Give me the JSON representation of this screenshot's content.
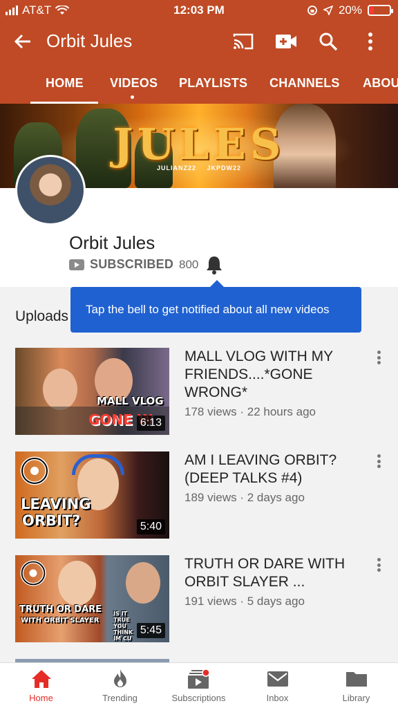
{
  "status_bar": {
    "carrier": "AT&T",
    "time": "12:03 PM",
    "battery_percent": "20%",
    "battery_level": 0.2,
    "battery_color": "#ff3b30"
  },
  "app_bar": {
    "title": "Orbit Jules",
    "background_color": "#bf4a25",
    "icons": [
      "back-arrow-icon",
      "cast-icon",
      "upload-video-icon",
      "search-icon",
      "more-vert-icon"
    ]
  },
  "tabs": [
    {
      "label": "HOME",
      "active": true
    },
    {
      "label": "VIDEOS",
      "active": false,
      "new_dot": true
    },
    {
      "label": "PLAYLISTS",
      "active": false
    },
    {
      "label": "CHANNELS",
      "active": false
    },
    {
      "label": "ABOU",
      "active": false
    }
  ],
  "banner": {
    "brand_text": "JULES",
    "handles": [
      "JULIANZ22",
      "JKPDW22"
    ]
  },
  "channel": {
    "name": "Orbit Jules",
    "subscribed_label": "SUBSCRIBED",
    "subscriber_count": "800"
  },
  "tooltip": {
    "text": "Tap the bell to get notified about all new videos",
    "color": "#1f61d1"
  },
  "uploads_label": "Uploads",
  "videos": [
    {
      "title": "MALL VLOG WITH MY FRIENDS....*GONE WRONG*",
      "views": "178 views",
      "age": "22 hours ago",
      "duration": "6:13",
      "thumb_caption_1": "MALL VLOG",
      "thumb_caption_2": "GONE W"
    },
    {
      "title": "AM I LEAVING ORBIT? (DEEP TALKS #4)",
      "views": "189 views",
      "age": "2 days ago",
      "duration": "5:40",
      "thumb_caption_1": "LEAVING",
      "thumb_caption_2": "ORBIT?"
    },
    {
      "title": "TRUTH OR DARE WITH ORBIT SLAYER ...",
      "views": "191 views",
      "age": "5 days ago",
      "duration": "5:45",
      "thumb_caption_1": "TRUTH OR DARE",
      "thumb_caption_2": "WITH ORBIT SLAYER",
      "thumb_caption_3": "IS IT TRUE YOU THINK IM CU"
    }
  ],
  "meta_separator": "·",
  "bottom_nav": [
    {
      "label": "Home",
      "icon": "home-icon",
      "active": true
    },
    {
      "label": "Trending",
      "icon": "trending-flame-icon",
      "active": false
    },
    {
      "label": "Subscriptions",
      "icon": "subscriptions-icon",
      "active": false,
      "badge": true
    },
    {
      "label": "Inbox",
      "icon": "inbox-mail-icon",
      "active": false
    },
    {
      "label": "Library",
      "icon": "library-folder-icon",
      "active": false
    }
  ],
  "colors": {
    "accent": "#bf4a25",
    "active_nav": "#e52d27",
    "tooltip": "#1f61d1"
  }
}
